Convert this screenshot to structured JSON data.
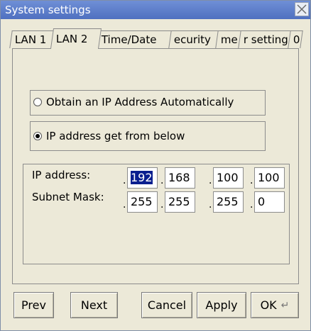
{
  "window": {
    "title": "System settings"
  },
  "tabs": [
    {
      "label": "LAN 1"
    },
    {
      "label": "LAN 2"
    },
    {
      "label": "Time/Date"
    },
    {
      "label": "ecurity"
    },
    {
      "label": "me"
    },
    {
      "label": "r setting"
    },
    {
      "label": "0"
    }
  ],
  "options": {
    "auto_label": "Obtain an IP Address Automatically",
    "manual_label": "IP address get from below",
    "selected": "manual"
  },
  "ip_address": {
    "label": "IP address:",
    "octets": [
      "192",
      "168",
      "100",
      "100"
    ]
  },
  "subnet_mask": {
    "label": "Subnet Mask:",
    "octets": [
      "255",
      "255",
      "255",
      "0"
    ]
  },
  "buttons": {
    "prev": "Prev",
    "next": "Next",
    "cancel": "Cancel",
    "apply": "Apply",
    "ok": "OK"
  },
  "icons": {
    "close": "close-icon",
    "enter": "enter-icon"
  },
  "colors": {
    "titlebar": "#5a7cc9",
    "selection": "#0a1f8f"
  }
}
